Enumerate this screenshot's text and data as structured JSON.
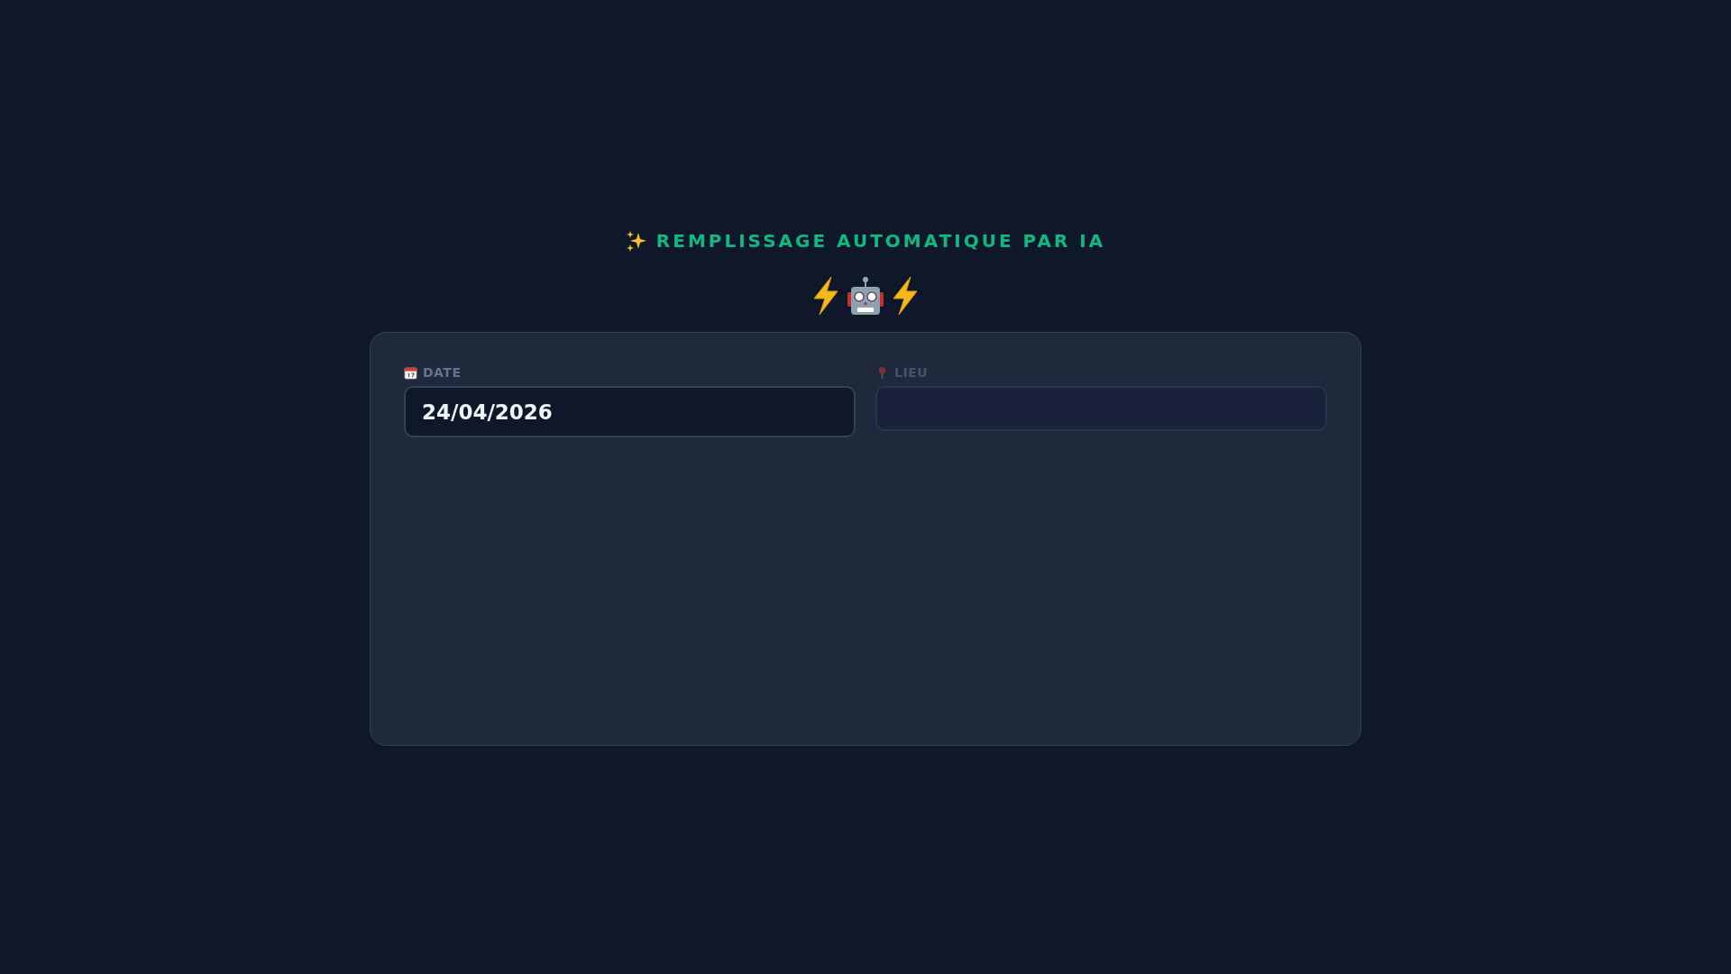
{
  "title": "REMPLISSAGE AUTOMATIQUE PAR IA",
  "fields": [
    {
      "kind": "date",
      "label": "DATE",
      "value": "24/04/2026",
      "disabled": false
    },
    {
      "kind": "place",
      "label": "LIEU",
      "disabled": true
    }
  ]
}
